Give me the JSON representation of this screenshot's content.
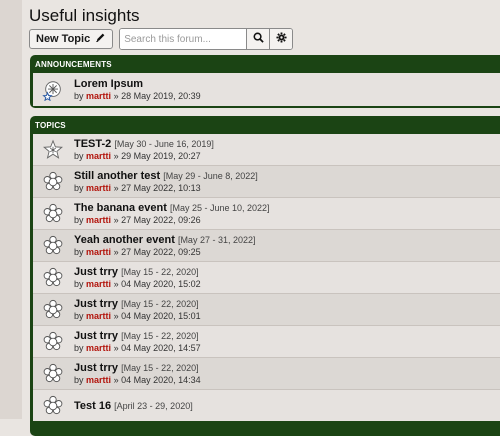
{
  "forum": {
    "title": "Useful insights"
  },
  "toolbar": {
    "new_topic_label": "New Topic",
    "search_placeholder": "Search this forum..."
  },
  "announcements": {
    "header": "ANNOUNCEMENTS",
    "items": [
      {
        "title": "Lorem Ipsum",
        "date_range": "",
        "by": "by",
        "author": "martti",
        "posted": "» 28 May 2019, 20:39"
      }
    ]
  },
  "topics": {
    "header": "TOPICS",
    "items": [
      {
        "title": "TEST-2",
        "date_range": "[May 30 - June 16, 2019]",
        "by": "by",
        "author": "martti",
        "posted": "» 29 May 2019, 20:27",
        "icon": "star-icon"
      },
      {
        "title": "Still another test",
        "date_range": "[May 29 - June 8, 2022]",
        "by": "by",
        "author": "martti",
        "posted": "» 27 May 2022, 10:13",
        "icon": "flower-icon"
      },
      {
        "title": "The banana event",
        "date_range": "[May 25 - June 10, 2022]",
        "by": "by",
        "author": "martti",
        "posted": "» 27 May 2022, 09:26",
        "icon": "flower-icon"
      },
      {
        "title": "Yeah another event",
        "date_range": "[May 27 - 31, 2022]",
        "by": "by",
        "author": "martti",
        "posted": "» 27 May 2022, 09:25",
        "icon": "flower-icon"
      },
      {
        "title": "Just trry",
        "date_range": "[May 15 - 22, 2020]",
        "by": "by",
        "author": "martti",
        "posted": "» 04 May 2020, 15:02",
        "icon": "flower-icon"
      },
      {
        "title": "Just trry",
        "date_range": "[May 15 - 22, 2020]",
        "by": "by",
        "author": "martti",
        "posted": "» 04 May 2020, 15:01",
        "icon": "flower-icon"
      },
      {
        "title": "Just trry",
        "date_range": "[May 15 - 22, 2020]",
        "by": "by",
        "author": "martti",
        "posted": "» 04 May 2020, 14:57",
        "icon": "flower-icon"
      },
      {
        "title": "Just trry",
        "date_range": "[May 15 - 22, 2020]",
        "by": "by",
        "author": "martti",
        "posted": "» 04 May 2020, 14:34",
        "icon": "flower-icon"
      },
      {
        "title": "Test 16",
        "date_range": "[April 23 - 29, 2020]",
        "by": "",
        "author": "",
        "posted": "",
        "icon": "flower-icon"
      }
    ]
  }
}
